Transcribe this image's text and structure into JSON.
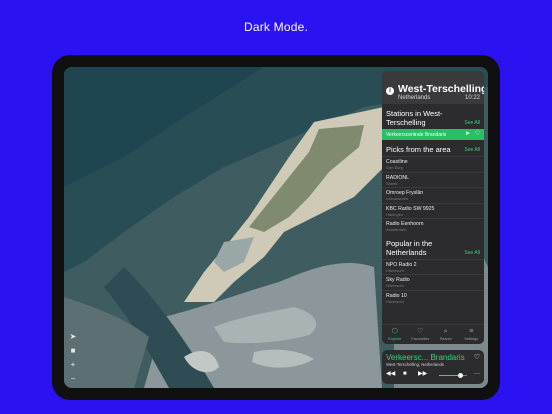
{
  "promo": {
    "title": "Dark Mode."
  },
  "panel": {
    "title": "West-Terschelling",
    "country": "Netherlands",
    "time": "10:22",
    "sections": [
      {
        "id": "stations",
        "heading": "Stations in West-Terschelling",
        "see_all": "See All"
      },
      {
        "id": "picks",
        "heading": "Picks from the area",
        "see_all": "See All"
      },
      {
        "id": "popular",
        "heading": "Popular in the Netherlands",
        "see_all": "See All"
      }
    ],
    "highlighted_station": "Verkeerscentrale Brandaris",
    "picks": [
      {
        "name": "Coastline",
        "sub": "Den Burg"
      },
      {
        "name": "RADIONL",
        "sub": "Sneek"
      },
      {
        "name": "Omroep Fryslân",
        "sub": "Leeuwarden"
      },
      {
        "name": "KBC Radio SW 9925",
        "sub": "Harlingen"
      },
      {
        "name": "Radio Eenhoorn",
        "sub": "Amsterdam"
      }
    ],
    "popular": [
      {
        "name": "NPO Radio 2",
        "sub": "Hilversum"
      },
      {
        "name": "Sky Radio",
        "sub": "Hilversum"
      },
      {
        "name": "Radio 10",
        "sub": "Hilversum"
      }
    ],
    "tabs": [
      {
        "label": "Explore",
        "icon": "explore-icon",
        "active": true
      },
      {
        "label": "Favourites",
        "icon": "heart-icon",
        "active": false
      },
      {
        "label": "Search",
        "icon": "search-icon",
        "active": false
      },
      {
        "label": "Settings",
        "icon": "settings-icon",
        "active": false
      }
    ]
  },
  "player": {
    "station": "Verkeersc... Brandaris",
    "location": "West-Terschelling, Netherlands",
    "volume": 0.75
  },
  "colors": {
    "background": "#2b12f2",
    "accent": "#3ad07a",
    "panel": "#2c2c2e"
  }
}
